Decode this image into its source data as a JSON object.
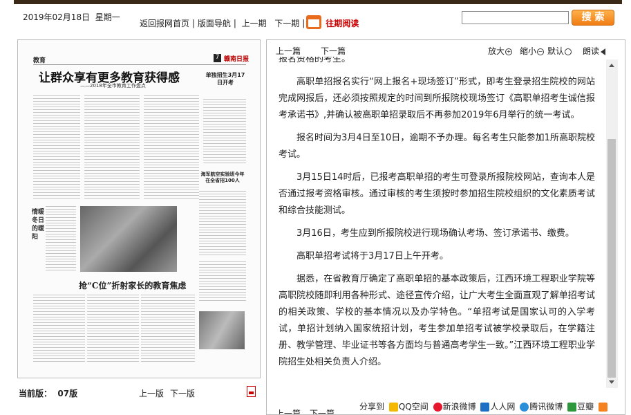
{
  "header": {
    "date": "2019年02月18日",
    "weekday": "星期一",
    "nav_home": "返回报网首页",
    "nav_layout": "版面导航",
    "nav_prev_issue": "上一期",
    "nav_next_issue": "下一期",
    "nav_past": "往期阅读",
    "search_button": "搜 索",
    "search_value": ""
  },
  "newspaper": {
    "section": "教育",
    "page_number": "7",
    "logo": "赣南日报",
    "headline": "让群众享有更多教育获得感",
    "subhead": "——2018年全市教育工作盘点",
    "side_headline": "单独招生3月17日开考",
    "box_headline": "海军航空实验班今年在全省招100人",
    "side_column": "情暖冬日的暖阳",
    "second_headline": "抢“C位”折射家长的教育焦虑"
  },
  "left_footer": {
    "current_label": "当前版：",
    "current_value": "07版",
    "prev": "上一版",
    "next": "下一版"
  },
  "reader": {
    "prev": "上一篇",
    "next": "下一篇",
    "zoom_in": "放大",
    "zoom_out": "缩小",
    "default": "默认",
    "read_aloud": "朗读",
    "paragraphs": [
      "报名资格的考生。",
      "高职单招报名实行“网上报名+现场签订”形式，即考生登录招生院校的网站完成网报后，还必须按照规定的时间到所报院校现场签订《高职单招考生诚信报考承诺书》,并确认被高职单招录取后不再参加2019年6月举行的统一考试。",
      "报名时间为3月4日至10日，逾期不予办理。每名考生只能参加1所高职院校考试。",
      "3月15日14时后，已报考高职单招的考生可登录所报院校网站，查询本人是否通过报考资格审核。通过审核的考生须按时参加招生院校组织的文化素质考试和综合技能测试。",
      "3月16日，考生应到所报院校进行现场确认考场、签订承诺书、缴费。",
      "高职单招考试将于3月17日上午开考。",
      "据悉，在省教育厅确定了高职单招的基本政策后，江西环境工程职业学院等高职院校随即利用各种形式、途径宣传介绍，让广大考生全面直观了解单招考试的相关政策、学校的基本情况以及办学特色。“单招考试是国家认可的入学考试，单招计划纳入国家统招计划，考生参加单招考试被学校录取后，在学籍注册、教学管理、毕业证书等各方面均与普通高考学生一致。”江西环境工程职业学院招生处相关负责人介绍。"
    ],
    "share_label": "分享到",
    "share_targets": [
      "QQ空间",
      "新浪微博",
      "人人网",
      "腾讯微博",
      "豆瓣"
    ],
    "bottom_prev": "上一篇",
    "bottom_next": "下一篇"
  }
}
